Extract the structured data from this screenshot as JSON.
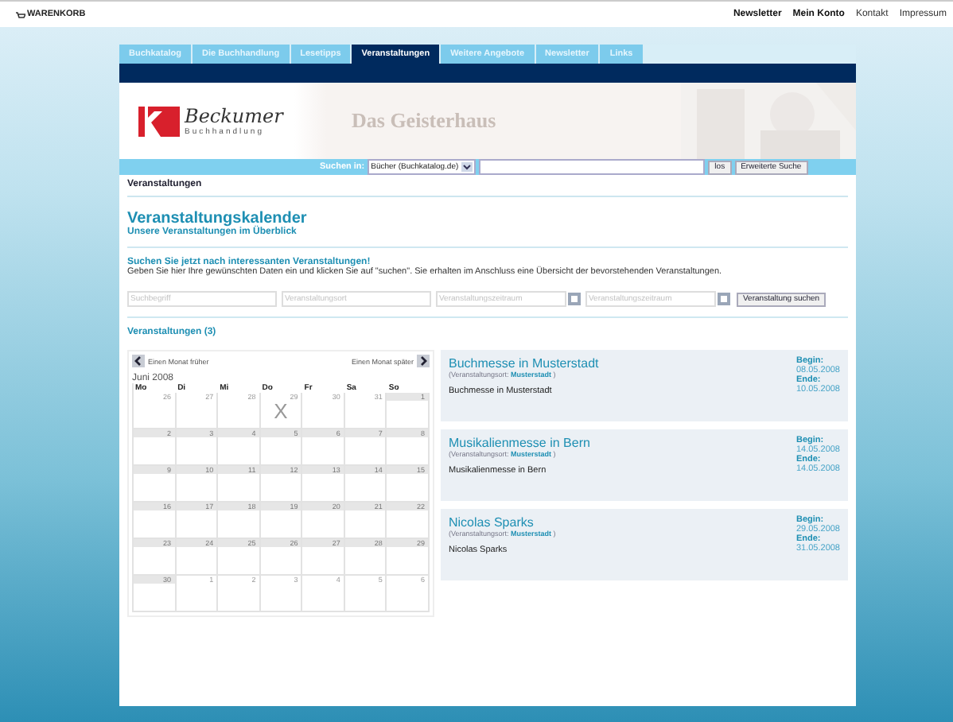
{
  "topbar": {
    "cart": "WARENKORB",
    "links": [
      {
        "label": "Newsletter",
        "bold": true
      },
      {
        "label": "Mein Konto",
        "bold": true
      },
      {
        "label": "Kontakt",
        "bold": false
      },
      {
        "label": "Impressum",
        "bold": false
      }
    ]
  },
  "tabs": [
    {
      "label": "Buchkatalog",
      "selected": false
    },
    {
      "label": "Die Buchhandlung",
      "selected": false
    },
    {
      "label": "Lesetipps",
      "selected": false
    },
    {
      "label": "Veranstaltungen",
      "selected": true
    },
    {
      "label": "Weitere Angebote",
      "selected": false
    },
    {
      "label": "Newsletter",
      "selected": false
    },
    {
      "label": "Links",
      "selected": false
    }
  ],
  "header": {
    "logo_name": "Beckumer",
    "logo_sub": "Buchhandlung",
    "banner_title": "Das Geisterhaus"
  },
  "search": {
    "label": "Suchen in:",
    "scope": "Bücher (Buchkatalog.de)",
    "go": "los",
    "advanced": "Erweiterte Suche"
  },
  "breadcrumb": "Veranstaltungen",
  "heading": "Veranstaltungskalender",
  "subheading": "Unsere Veranstaltungen im Überblick",
  "finder": {
    "title": "Suchen Sie jetzt nach interessanten Veranstaltungen!",
    "text": "Geben Sie hier Ihre gewünschten Daten ein und klicken Sie auf \"suchen\". Sie erhalten im Anschluss eine Übersicht der bevorstehenden Veranstaltungen.",
    "fields": [
      {
        "placeholder": "Suchbegriff",
        "kind": "text"
      },
      {
        "placeholder": "Veranstaltungsort",
        "kind": "text"
      },
      {
        "placeholder": "Veranstaltungszeitraum",
        "kind": "date"
      },
      {
        "placeholder": "Veranstaltungszeitraum",
        "kind": "date"
      }
    ],
    "button": "Veranstaltung suchen"
  },
  "results_title": "Veranstaltungen (3)",
  "calendar": {
    "prev": "Einen Monat früher",
    "next": "Einen Monat später",
    "month": "Juni 2008",
    "weekdays": [
      "Mo",
      "Di",
      "Mi",
      "Do",
      "Fr",
      "Sa",
      "So"
    ],
    "days": [
      {
        "day": "26",
        "outside": true
      },
      {
        "day": "27",
        "outside": true
      },
      {
        "day": "28",
        "outside": true
      },
      {
        "day": "29",
        "outside": true,
        "mark": "X"
      },
      {
        "day": "30",
        "outside": true
      },
      {
        "day": "31",
        "outside": true
      },
      {
        "day": "1",
        "outside": false
      },
      {
        "day": "2",
        "outside": false
      },
      {
        "day": "3",
        "outside": false
      },
      {
        "day": "4",
        "outside": false
      },
      {
        "day": "5",
        "outside": false
      },
      {
        "day": "6",
        "outside": false
      },
      {
        "day": "7",
        "outside": false
      },
      {
        "day": "8",
        "outside": false
      },
      {
        "day": "9",
        "outside": false
      },
      {
        "day": "10",
        "outside": false
      },
      {
        "day": "11",
        "outside": false
      },
      {
        "day": "12",
        "outside": false
      },
      {
        "day": "13",
        "outside": false
      },
      {
        "day": "14",
        "outside": false
      },
      {
        "day": "15",
        "outside": false
      },
      {
        "day": "16",
        "outside": false
      },
      {
        "day": "17",
        "outside": false
      },
      {
        "day": "18",
        "outside": false
      },
      {
        "day": "19",
        "outside": false
      },
      {
        "day": "20",
        "outside": false
      },
      {
        "day": "21",
        "outside": false
      },
      {
        "day": "22",
        "outside": false
      },
      {
        "day": "23",
        "outside": false
      },
      {
        "day": "24",
        "outside": false
      },
      {
        "day": "25",
        "outside": false
      },
      {
        "day": "26",
        "outside": false
      },
      {
        "day": "27",
        "outside": false
      },
      {
        "day": "28",
        "outside": false
      },
      {
        "day": "29",
        "outside": false
      },
      {
        "day": "30",
        "outside": false
      },
      {
        "day": "1",
        "outside": true
      },
      {
        "day": "2",
        "outside": true
      },
      {
        "day": "3",
        "outside": true
      },
      {
        "day": "4",
        "outside": true
      },
      {
        "day": "5",
        "outside": true
      },
      {
        "day": "6",
        "outside": true
      }
    ]
  },
  "events": [
    {
      "title": "Buchmesse in Musterstadt",
      "place_label": "(Veranstaltungsort:",
      "place": "Musterstadt",
      "place_close": ")",
      "description": "Buchmesse in Musterstadt",
      "begin_label": "Begin:",
      "begin": "08.05.2008",
      "end_label": "Ende:",
      "end": "10.05.2008"
    },
    {
      "title": "Musikalienmesse in Bern",
      "place_label": "(Veranstaltungsort:",
      "place": "Musterstadt",
      "place_close": ")",
      "description": "Musikalienmesse in Bern",
      "begin_label": "Begin:",
      "begin": "14.05.2008",
      "end_label": "Ende:",
      "end": "14.05.2008"
    },
    {
      "title": "Nicolas Sparks",
      "place_label": "(Veranstaltungsort:",
      "place": "Musterstadt",
      "place_close": ")",
      "description": "Nicolas Sparks",
      "begin_label": "Begin:",
      "begin": "29.05.2008",
      "end_label": "Ende:",
      "end": "31.05.2008"
    }
  ]
}
